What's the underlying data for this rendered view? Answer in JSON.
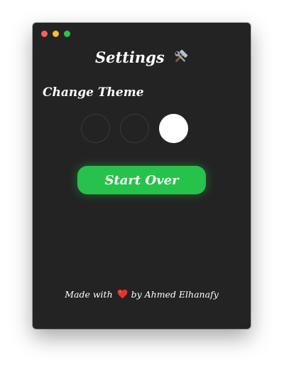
{
  "window": {
    "controls": [
      "close",
      "minimize",
      "zoom"
    ]
  },
  "header": {
    "title": "Settings",
    "icon": "hammer-and-wrench-icon"
  },
  "theme": {
    "label": "Change Theme",
    "options": [
      {
        "name": "dark-1",
        "color": "#232323"
      },
      {
        "name": "dark-2",
        "color": "#232323"
      },
      {
        "name": "light",
        "color": "#ffffff"
      }
    ]
  },
  "actions": {
    "start_over_label": "Start Over",
    "accent": "#27c24c"
  },
  "footer": {
    "prefix": "Made with",
    "icon": "heart-icon",
    "suffix": "by Ahmed Elhanafy"
  }
}
